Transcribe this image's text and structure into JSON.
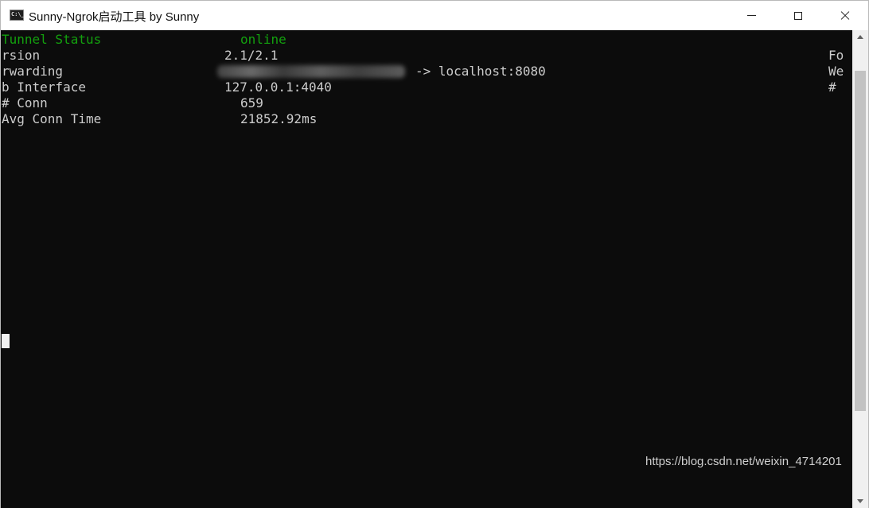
{
  "window": {
    "title": "Sunny-Ngrok启动工具 by Sunny",
    "icon_text": "C:\\_"
  },
  "console": {
    "lines": [
      {
        "label": "Tunnel Status",
        "value": "online"
      },
      {
        "label": "rsion",
        "value": "2.1/2.1",
        "right": "Fo"
      },
      {
        "label": "rwarding",
        "value": "-> localhost:8080",
        "right": "We"
      },
      {
        "label": "b Interface",
        "value": "127.0.0.1:4040",
        "right": "#"
      },
      {
        "label": "# Conn",
        "value": "659"
      },
      {
        "label": "Avg Conn Time",
        "value": "21852.92ms"
      }
    ],
    "colors": {
      "background": "#0c0c0c",
      "text": "#cccccc",
      "status": "#13a10e"
    }
  },
  "watermark": "https://blog.csdn.net/weixin_4714201",
  "icons": [
    "console-app-icon",
    "minimize-icon",
    "maximize-icon",
    "close-icon",
    "scroll-up-icon",
    "scroll-down-icon"
  ]
}
